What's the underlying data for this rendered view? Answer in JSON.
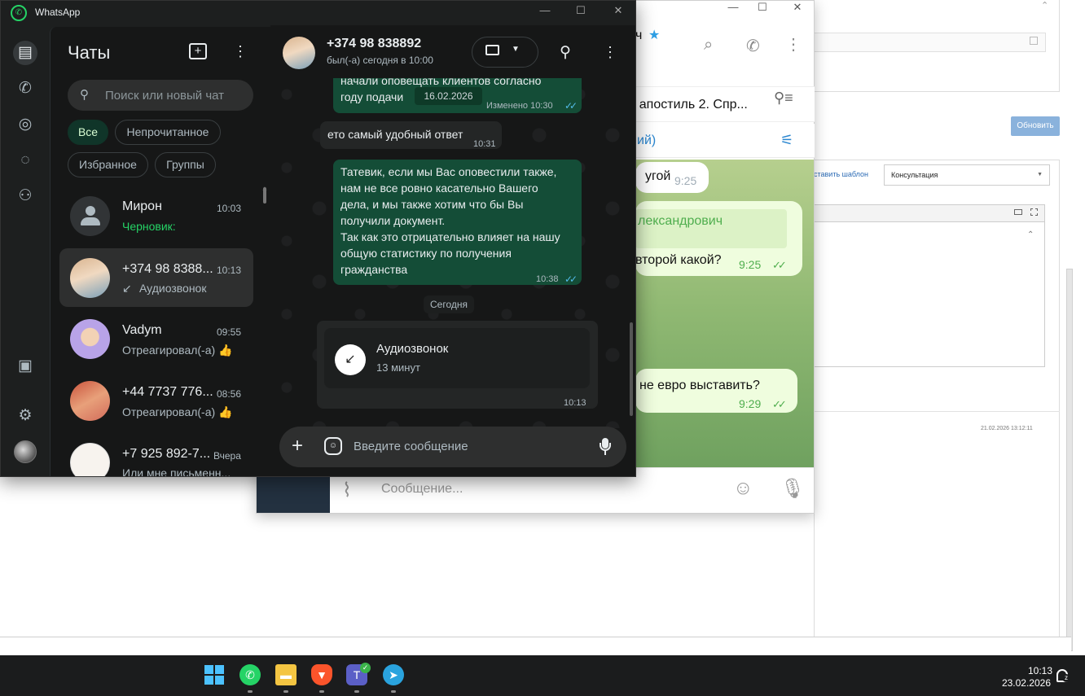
{
  "background_app": {
    "update_button": "Обновить",
    "insert_template_link": "ставить шаблон",
    "template_select": "Консультация",
    "timestamp": "21.02.2026 13:12:11"
  },
  "telegram": {
    "chat_name_fragment": "ч",
    "pinned_text": "- апостиль 2. Спр...",
    "filter_text": "ий)",
    "messages": [
      {
        "text": "угой",
        "time": "9:25",
        "direction": "in"
      },
      {
        "reply_to": "лександрович",
        "text": "второй какой?",
        "time": "9:25",
        "direction": "out"
      },
      {
        "text": "не евро выставить?",
        "time": "9:29",
        "direction": "out"
      }
    ],
    "composer_placeholder": "Сообщение..."
  },
  "whatsapp": {
    "app_title": "WhatsApp",
    "list_title": "Чаты",
    "search_placeholder": "Поиск или новый чат",
    "filters": [
      {
        "label": "Все",
        "active": true
      },
      {
        "label": "Непрочитанное",
        "active": false
      },
      {
        "label": "Избранное",
        "active": false
      },
      {
        "label": "Группы",
        "active": false
      }
    ],
    "chats": [
      {
        "name": "Мирон",
        "time": "10:03",
        "preview": "Черновик:",
        "draft": true,
        "selected": false
      },
      {
        "name": "+374 98 8388...",
        "time": "10:13",
        "preview": "Аудиозвонок",
        "selected": true
      },
      {
        "name": "Vadym",
        "time": "09:55",
        "preview": "Отреагировал(-а) 👍",
        "selected": false
      },
      {
        "name": "+44 7737 776...",
        "time": "08:56",
        "preview": "Отреагировал(-а) 👍",
        "selected": false
      },
      {
        "name": "+7 925 892-7...",
        "time": "Вчера",
        "preview": "Или мне письменн...",
        "selected": false
      }
    ],
    "conversation": {
      "contact_name": "+374 98 838892",
      "status": "был(-а) сегодня в 10:00",
      "messages": [
        {
          "line1": "начали оповещать клиентов согласно",
          "line2": "году подачи",
          "date_chip": "16.02.2026",
          "meta": "Изменено 10:30",
          "direction": "out"
        },
        {
          "text": "ето самый удобный ответ",
          "time": "10:31",
          "direction": "in"
        },
        {
          "lines": [
            "Татевик, если мы Вас оповестили также,",
            "нам не все ровно касательно Вашего",
            "дела, и мы также хотим что бы Вы",
            "получили документ.",
            "Так как это отрицательно влияет на нашу",
            "общую статистику по получения",
            "гражданства"
          ],
          "time": "10:38",
          "direction": "out"
        }
      ],
      "date_separator": "Сегодня",
      "call": {
        "title": "Аудиозвонок",
        "duration": "13 минут",
        "time": "10:13"
      },
      "composer_placeholder": "Введите сообщение"
    }
  },
  "taskbar": {
    "time": "10:13",
    "date": "23.02.2026",
    "apps": [
      "start-icon",
      "whatsapp-icon",
      "file-explorer-icon",
      "brave-icon",
      "teams-icon",
      "telegram-icon"
    ]
  },
  "colors": {
    "wa_accent": "#25d366",
    "wa_outgoing_bubble": "#144d37",
    "tg_accent": "#2a86d0",
    "tg_outgoing_bubble": "#effdde"
  }
}
